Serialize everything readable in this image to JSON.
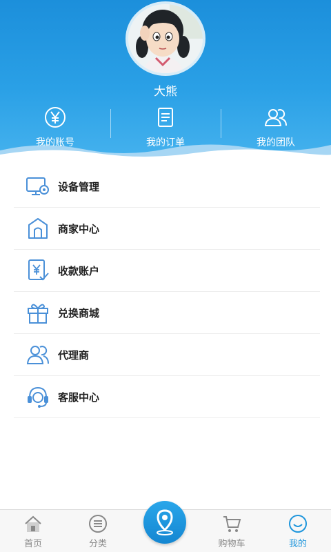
{
  "profile": {
    "username": "大熊"
  },
  "stats": [
    {
      "label": "我的账号",
      "icon": "yen-circle-icon"
    },
    {
      "label": "我的订单",
      "icon": "document-icon"
    },
    {
      "label": "我的团队",
      "icon": "team-icon"
    }
  ],
  "menu": [
    {
      "label": "设备管理",
      "icon": "monitor-gear-icon"
    },
    {
      "label": "商家中心",
      "icon": "shop-icon"
    },
    {
      "label": "收款账户",
      "icon": "yen-receipt-icon"
    },
    {
      "label": "兑换商城",
      "icon": "gift-icon"
    },
    {
      "label": "代理商",
      "icon": "agents-icon"
    },
    {
      "label": "客服中心",
      "icon": "headset-icon"
    }
  ],
  "tabbar": {
    "tabs": [
      {
        "label": "首页",
        "icon": "home-icon"
      },
      {
        "label": "分类",
        "icon": "list-circle-icon"
      },
      {
        "label": "",
        "icon": "location-pin-icon"
      },
      {
        "label": "购物车",
        "icon": "cart-icon"
      },
      {
        "label": "我的",
        "icon": "smile-icon"
      }
    ],
    "active_index": 4
  },
  "colors": {
    "header_blue": "#1c8fdb",
    "accent": "#1f96dc",
    "icon_blue": "#4a90d8",
    "tab_gray": "#888888"
  }
}
